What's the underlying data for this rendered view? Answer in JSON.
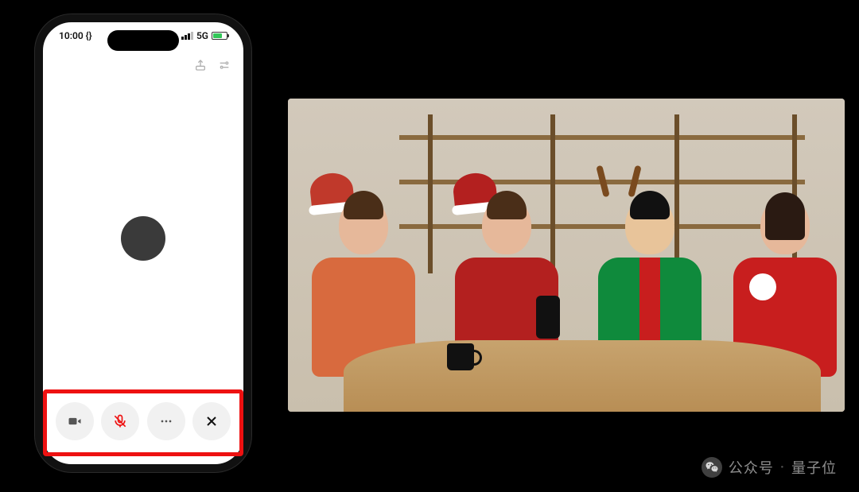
{
  "phone": {
    "status": {
      "time": "10:00 {}",
      "network_label": "5G"
    },
    "top_actions": {
      "upload_icon": "share-icon",
      "settings_icon": "sliders-icon"
    },
    "call_bar": {
      "video": "video-icon",
      "mic_muted": "mic-off-icon",
      "more": "more-icon",
      "close": "close-icon"
    }
  },
  "watermark": {
    "prefix": "公众号",
    "separator": "·",
    "name": "量子位"
  }
}
